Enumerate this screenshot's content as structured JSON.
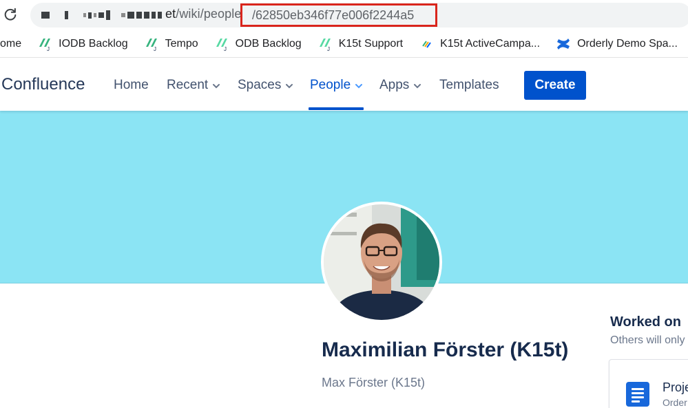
{
  "browser": {
    "url_visible": "et/wiki/people/62850eb346f77e006f2244a5",
    "url_host_end": "et",
    "url_path": "/wiki/people",
    "url_id": "/62850eb346f77e006f2244a5"
  },
  "bookmarks": [
    {
      "label": "ome",
      "icon": "home-icon"
    },
    {
      "label": "IODB Backlog",
      "icon": "jira-green-icon"
    },
    {
      "label": "Tempo",
      "icon": "jira-green-icon"
    },
    {
      "label": "ODB Backlog",
      "icon": "jira-green-icon"
    },
    {
      "label": "K15t Support",
      "icon": "jira-green-icon"
    },
    {
      "label": "K15t ActiveCampa...",
      "icon": "activecampaign-icon"
    },
    {
      "label": "Orderly Demo Spa...",
      "icon": "confluence-icon"
    }
  ],
  "nav": {
    "brand": "Confluence",
    "items": [
      {
        "label": "Home"
      },
      {
        "label": "Recent"
      },
      {
        "label": "Spaces"
      },
      {
        "label": "People"
      },
      {
        "label": "Apps"
      },
      {
        "label": "Templates"
      }
    ],
    "active_item": "People",
    "create_label": "Create"
  },
  "profile": {
    "full_name": "Maximilian Förster (K15t)",
    "public_name": "Max Förster (K15t)",
    "cover_color": "#8be4f4"
  },
  "worked_on": {
    "title": "Worked on",
    "subtitle": "Others will only",
    "card_title": "Proje",
    "card_subtitle": "Order"
  },
  "colors": {
    "accent": "#0052cc",
    "highlight_box": "#d9251c"
  }
}
